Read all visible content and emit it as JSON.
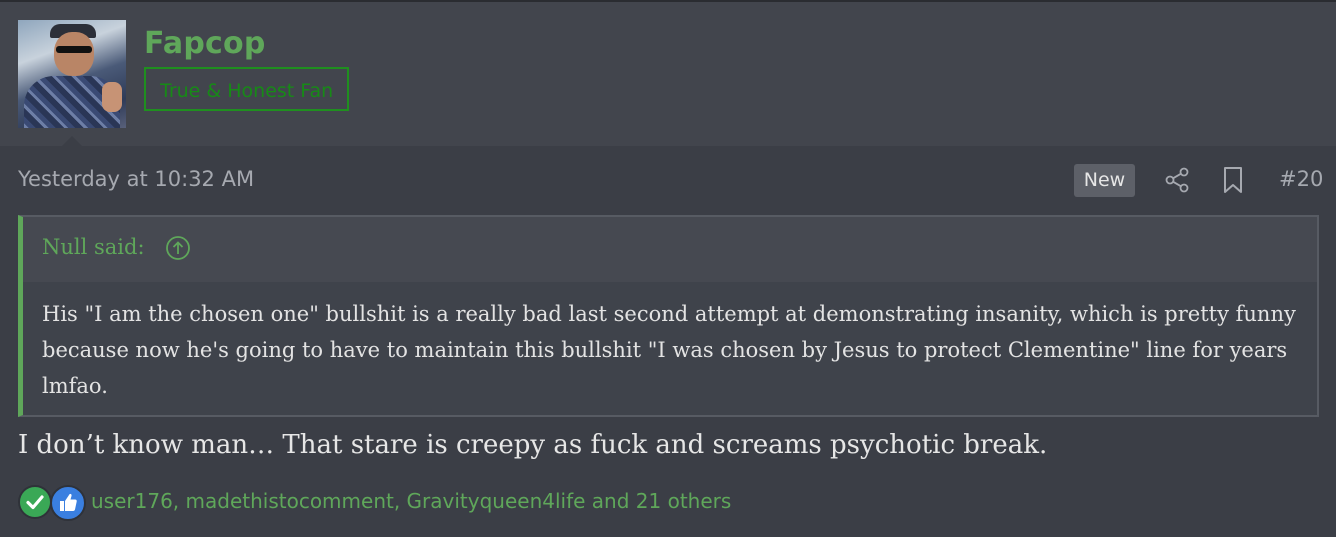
{
  "user": {
    "name": "Fapcop",
    "title_badge": "True & Honest Fan"
  },
  "post": {
    "timestamp": "Yesterday at 10:32 AM",
    "new_label": "New",
    "number": "#20",
    "share_icon": "share-icon",
    "bookmark_icon": "bookmark-icon",
    "body": "I don’t know man… That stare is creepy as fuck and screams psychotic break."
  },
  "quote": {
    "author": "Null said:",
    "expand_icon": "arrow-up-circle-icon",
    "text": "His \"I am the chosen one\" bullshit is a really bad last second attempt at demonstrating insanity, which is pretty funny because now he's going to have to maintain this bullshit \"I was chosen by Jesus to protect Clementine\" line for years lmfao."
  },
  "reactions": {
    "icons": [
      "check-reaction-icon",
      "like-reaction-icon"
    ],
    "summary": "user176, madethistocomment, Gravityqueen4life and 21 others"
  },
  "colors": {
    "background": "#3b3e46",
    "header": "#42454d",
    "accent_green": "#5fa75a",
    "badge_green": "#1f8f1f",
    "text": "#e3e3e3",
    "muted": "#a6a9b0"
  }
}
